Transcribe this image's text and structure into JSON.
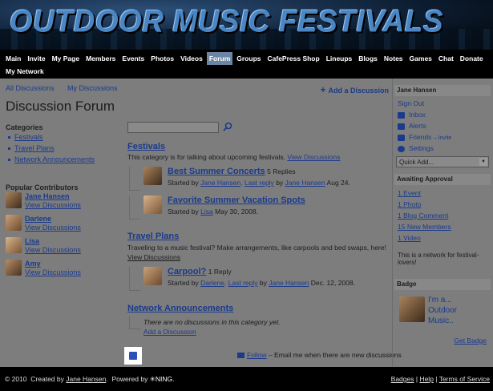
{
  "banner": {
    "title": "OUTDOOR MUSIC FESTIVALS"
  },
  "nav": {
    "items": [
      "Main",
      "Invite",
      "My Page",
      "Members",
      "Events",
      "Photos",
      "Videos",
      "Forum",
      "Groups",
      "CafePress Shop",
      "Lineups",
      "Blogs",
      "Notes",
      "Games",
      "Chat",
      "Donate",
      "My Network"
    ],
    "active": "Forum"
  },
  "top_links": {
    "all": "All Discussions",
    "mine": "My Discussions",
    "add": "Add a Discussion"
  },
  "page_title": "Discussion Forum",
  "categories": {
    "heading": "Categories",
    "items": [
      "Festivals",
      "Travel Plans",
      "Network Announcements"
    ]
  },
  "popular": {
    "heading": "Popular Contributors",
    "people": [
      {
        "name": "Jane Hansen",
        "link": "View Discussions"
      },
      {
        "name": "Darlene",
        "link": "View Discussions"
      },
      {
        "name": "Lisa",
        "link": "View Discussions"
      },
      {
        "name": "Amy",
        "link": "View Discussions"
      }
    ]
  },
  "sections": [
    {
      "title": "Festivals",
      "desc": "This category is for talking about upcoming festivals.",
      "view_link": "View Discussions",
      "discussions": [
        {
          "title": "Best Summer Concerts",
          "replies": "5 Replies",
          "started_by": "Started by",
          "author": "Jane Hansen",
          "last_reply": "Last reply",
          "by": "by",
          "reply_author": "Jane Hansen",
          "date": "Aug 24."
        },
        {
          "title": "Favorite Summer Vacation Spots",
          "replies": "",
          "started_by": "Started by",
          "author": "Lisa",
          "date": "May 30, 2008."
        }
      ]
    },
    {
      "title": "Travel Plans",
      "desc": "Traveling to a music festival? Make arrangements, like carpools and bed swaps, here!",
      "view_link": "View Discussions",
      "discussions": [
        {
          "title": "Carpool?",
          "replies": "1 Reply",
          "started_by": "Started by",
          "author": "Darlene",
          "last_reply": "Last reply",
          "by": "by",
          "reply_author": "Jane Hansen",
          "date": "Dec. 12, 2008."
        }
      ]
    },
    {
      "title": "Network Announcements",
      "empty": "There are no discussions in this category yet.",
      "add": "Add a Discussion"
    }
  ],
  "follow": {
    "link": "Follow",
    "text": "– Email me when there are new discussions"
  },
  "sidebar": {
    "user": "Jane Hansen",
    "sign_out": "Sign Out",
    "inbox": "Inbox",
    "alerts": "Alerts",
    "friends": "Friends",
    "invite": "– Invite",
    "settings": "Settings",
    "quick_add": "Quick Add...",
    "awaiting": "Awaiting Approval",
    "approvals": [
      "1 Event",
      "1 Photo",
      "1 Blog Comment",
      "15 New Members",
      "1 Video"
    ],
    "network_note": "This is a network for festival-lovers!",
    "badge_head": "Badge",
    "badge_text_1": "I'm a...",
    "badge_text_2": "Outdoor",
    "badge_text_3": "Music..",
    "get_badge": "Get Badge"
  },
  "footer": {
    "copyright": "© 2010",
    "created_by": "Created by",
    "creator": "Jane Hansen",
    "powered": "Powered by",
    "ning": "NING.",
    "badges": "Badges",
    "help": "Help",
    "terms": "Terms of Service"
  },
  "colors": {
    "link": "#1a3a8c",
    "nav_active": "#6b86a5",
    "page_bg": "#7d7d7d"
  }
}
